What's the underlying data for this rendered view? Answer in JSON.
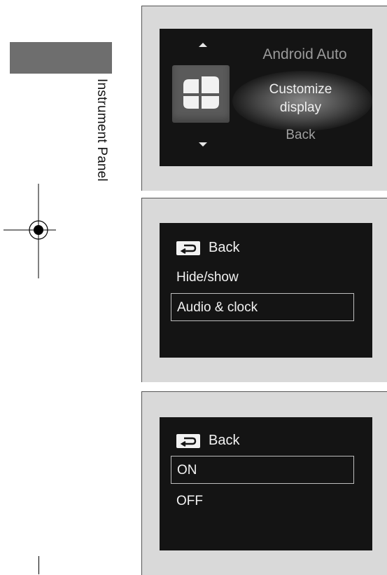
{
  "side": {
    "section_label": "Instrument Panel"
  },
  "panel1": {
    "menu": {
      "prev": "Android Auto",
      "current": "Customize\ndisplay",
      "next": "Back"
    },
    "icons": {
      "up": "arrow-up-icon",
      "down": "arrow-down-icon",
      "tile": "widget-grid-icon"
    }
  },
  "panel2": {
    "back": "Back",
    "items": [
      "Hide/show",
      "Audio & clock"
    ],
    "selected_index": 1
  },
  "panel3": {
    "back": "Back",
    "items": [
      "ON",
      "OFF"
    ],
    "selected_index": 0
  },
  "colors": {
    "screen_bg": "#141414",
    "panel_bg": "#d9d9d9",
    "text": "#f2f2f2",
    "side_tab": "#6e6e6e"
  }
}
